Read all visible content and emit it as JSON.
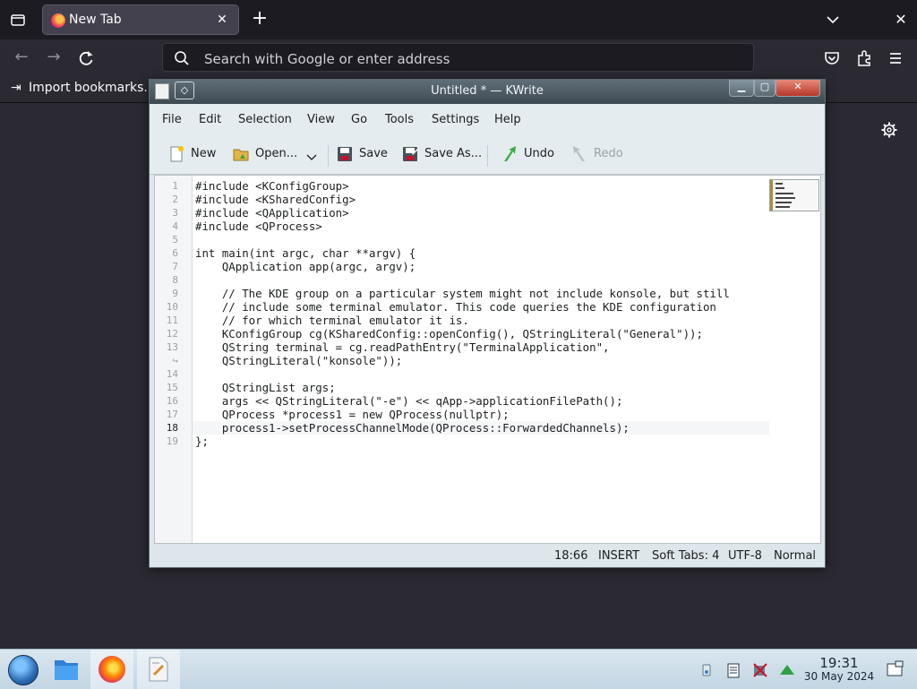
{
  "browser": {
    "tab": {
      "title": "New Tab",
      "close_glyph": "✕"
    },
    "new_tab_glyph": "+",
    "window_close_glyph": "✕",
    "urlbar": {
      "placeholder": "Search with Google or enter address"
    },
    "bookmarks": {
      "import_label": "Import bookmarks..."
    },
    "icons": [
      "list-all-tabs-icon",
      "firefox-favicon-icon",
      "back-icon",
      "forward-icon",
      "reload-icon",
      "search-icon",
      "pocket-icon",
      "extensions-icon",
      "menu-icon",
      "import-icon",
      "settings-gear-icon"
    ]
  },
  "kwrite": {
    "title": "Untitled * — KWrite",
    "menu": [
      "File",
      "Edit",
      "Selection",
      "View",
      "Go",
      "Tools",
      "Settings",
      "Help"
    ],
    "toolbar": {
      "new": "New",
      "open": "Open...",
      "save": "Save",
      "save_as": "Save As...",
      "undo": "Undo",
      "redo": "Redo"
    },
    "lines": [
      {
        "n": "1",
        "text": "#include <KConfigGroup>"
      },
      {
        "n": "2",
        "text": "#include <KSharedConfig>"
      },
      {
        "n": "3",
        "text": "#include <QApplication>"
      },
      {
        "n": "4",
        "text": "#include <QProcess>"
      },
      {
        "n": "5",
        "text": ""
      },
      {
        "n": "6",
        "text": "int main(int argc, char **argv) {"
      },
      {
        "n": "7",
        "text": "    QApplication app(argc, argv);"
      },
      {
        "n": "8",
        "text": ""
      },
      {
        "n": "9",
        "text": "    // The KDE group on a particular system might not include konsole, but still"
      },
      {
        "n": "10",
        "text": "    // include some terminal emulator. This code queries the KDE configuration"
      },
      {
        "n": "11",
        "text": "    // for which terminal emulator it is."
      },
      {
        "n": "12",
        "text": "    KConfigGroup cg(KSharedConfig::openConfig(), QStringLiteral(\"General\"));"
      },
      {
        "n": "13",
        "text": "    QString terminal = cg.readPathEntry(\"TerminalApplication\","
      },
      {
        "n": "↪",
        "text": "    QStringLiteral(\"konsole\"));"
      },
      {
        "n": "14",
        "text": ""
      },
      {
        "n": "15",
        "text": "    QStringList args;"
      },
      {
        "n": "16",
        "text": "    args << QStringLiteral(\"-e\") << qApp->applicationFilePath();"
      },
      {
        "n": "17",
        "text": "    QProcess *process1 = new QProcess(nullptr);"
      },
      {
        "n": "18",
        "text": "    process1->setProcessChannelMode(QProcess::ForwardedChannels);"
      },
      {
        "n": "19",
        "text": "};"
      }
    ],
    "current_line": "18",
    "status": {
      "cursor": "18:66",
      "mode": "INSERT",
      "indent": "Soft Tabs: 4",
      "encoding": "UTF-8",
      "input_mode": "Normal"
    }
  },
  "taskbar": {
    "clock": {
      "time": "19:31",
      "date": "30 May 2024"
    },
    "items": [
      "start-button",
      "file-manager",
      "firefox",
      "kwrite"
    ],
    "active": "firefox"
  }
}
